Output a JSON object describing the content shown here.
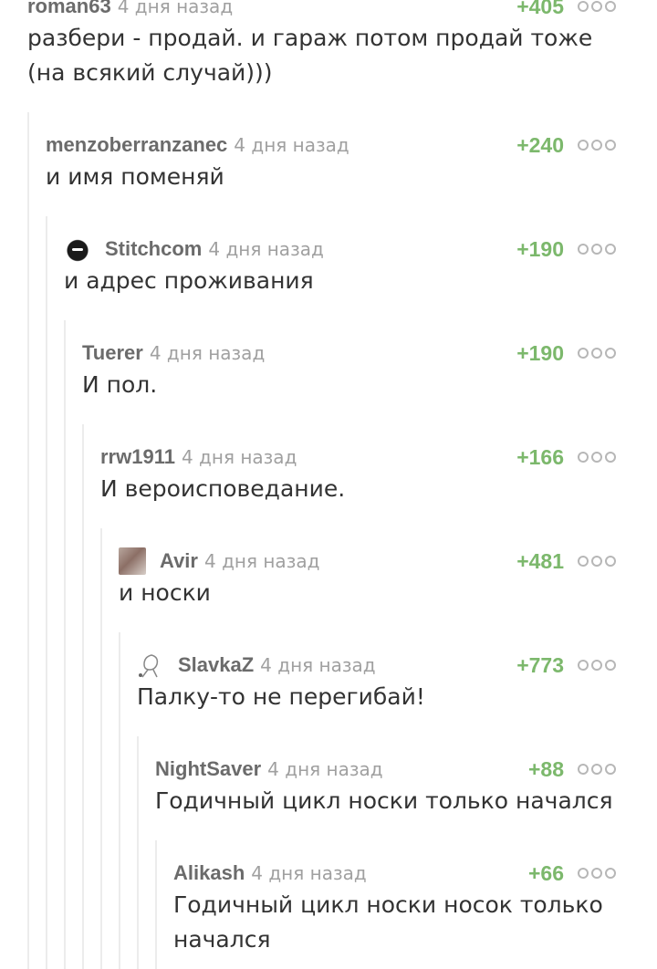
{
  "comments": [
    {
      "author": "roman63",
      "time": "4 дня назад",
      "rating": "+405",
      "text": "разбери - продай. и гараж потом продай тоже (на всякий случай)))",
      "avatar": null
    },
    {
      "author": "menzoberranzanec",
      "time": "4 дня назад",
      "rating": "+240",
      "text": "и имя поменяй",
      "avatar": null
    },
    {
      "author": "Stitchcom",
      "time": "4 дня назад",
      "rating": "+190",
      "text": "и адрес проживания",
      "avatar": "dark"
    },
    {
      "author": "Tuerer",
      "time": "4 дня назад",
      "rating": "+190",
      "text": "И пол.",
      "avatar": null
    },
    {
      "author": "rrw1911",
      "time": "4 дня назад",
      "rating": "+166",
      "text": "И вероисповедание.",
      "avatar": null
    },
    {
      "author": "Avir",
      "time": "4 дня назад",
      "rating": "+481",
      "text": "и носки",
      "avatar": "photo"
    },
    {
      "author": "SlavkaZ",
      "time": "4 дня назад",
      "rating": "+773",
      "text": "Палку-то не перегибай!",
      "avatar": "sketch"
    },
    {
      "author": "NightSaver",
      "time": "4 дня назад",
      "rating": "+88",
      "text": "Годичный цикл носки только начался",
      "avatar": null
    },
    {
      "author": "Alikash",
      "time": "4 дня назад",
      "rating": "+66",
      "text": "Годичный цикл носки носок только начался",
      "avatar": null
    }
  ]
}
